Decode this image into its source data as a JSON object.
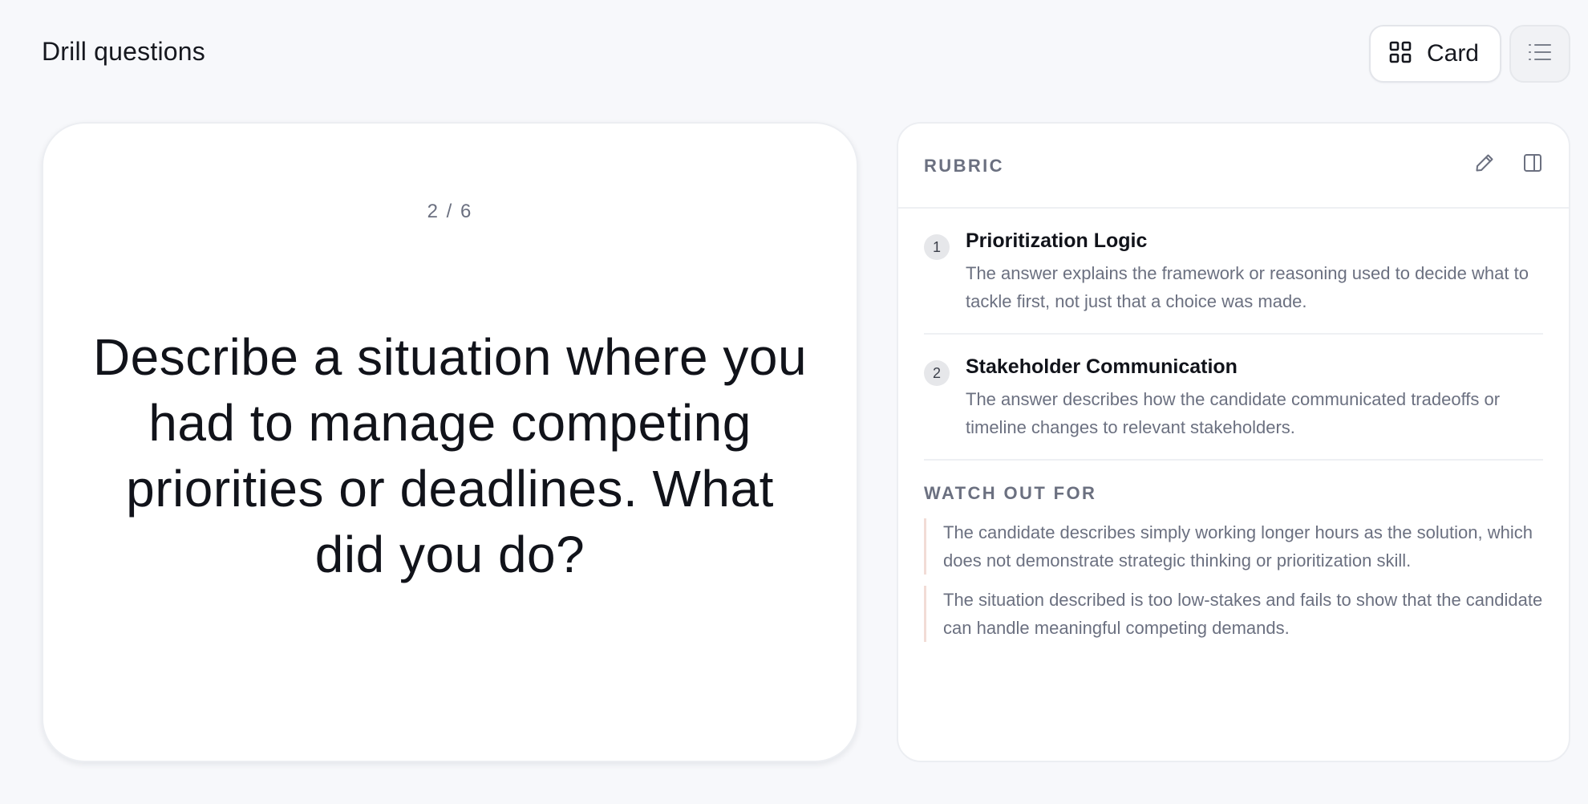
{
  "header": {
    "title": "Drill questions",
    "view_toggle": {
      "card_label": "Card",
      "card_icon": "grid-icon",
      "list_icon": "list-icon"
    }
  },
  "card": {
    "counter": "2 / 6",
    "question": "Describe a situation where you had to manage competing priorities or deadlines. What did you do?"
  },
  "rubric": {
    "label": "RUBRIC",
    "edit_icon": "pencil-icon",
    "panel_icon": "sidebar-panel-icon",
    "criteria": [
      {
        "number": "1",
        "name": "Prioritization Logic",
        "description": "The answer explains the framework or reasoning used to decide what to tackle first, not just that a choice was made."
      },
      {
        "number": "2",
        "name": "Stakeholder Communication",
        "description": "The answer describes how the candidate communicated tradeoffs or timeline changes to relevant stakeholders."
      }
    ],
    "watch_out": {
      "label": "WATCH OUT FOR",
      "items": [
        "The candidate describes simply working longer hours as the solution, which does not demonstrate strategic thinking or prioritization skill.",
        "The situation described is too low-stakes and fails to show that the candidate can handle meaningful competing demands."
      ]
    }
  },
  "colors": {
    "background": "#f7f8fb",
    "text_primary": "#11131a",
    "text_muted": "#6b7080",
    "watch_accent": "#f2dcd6"
  }
}
